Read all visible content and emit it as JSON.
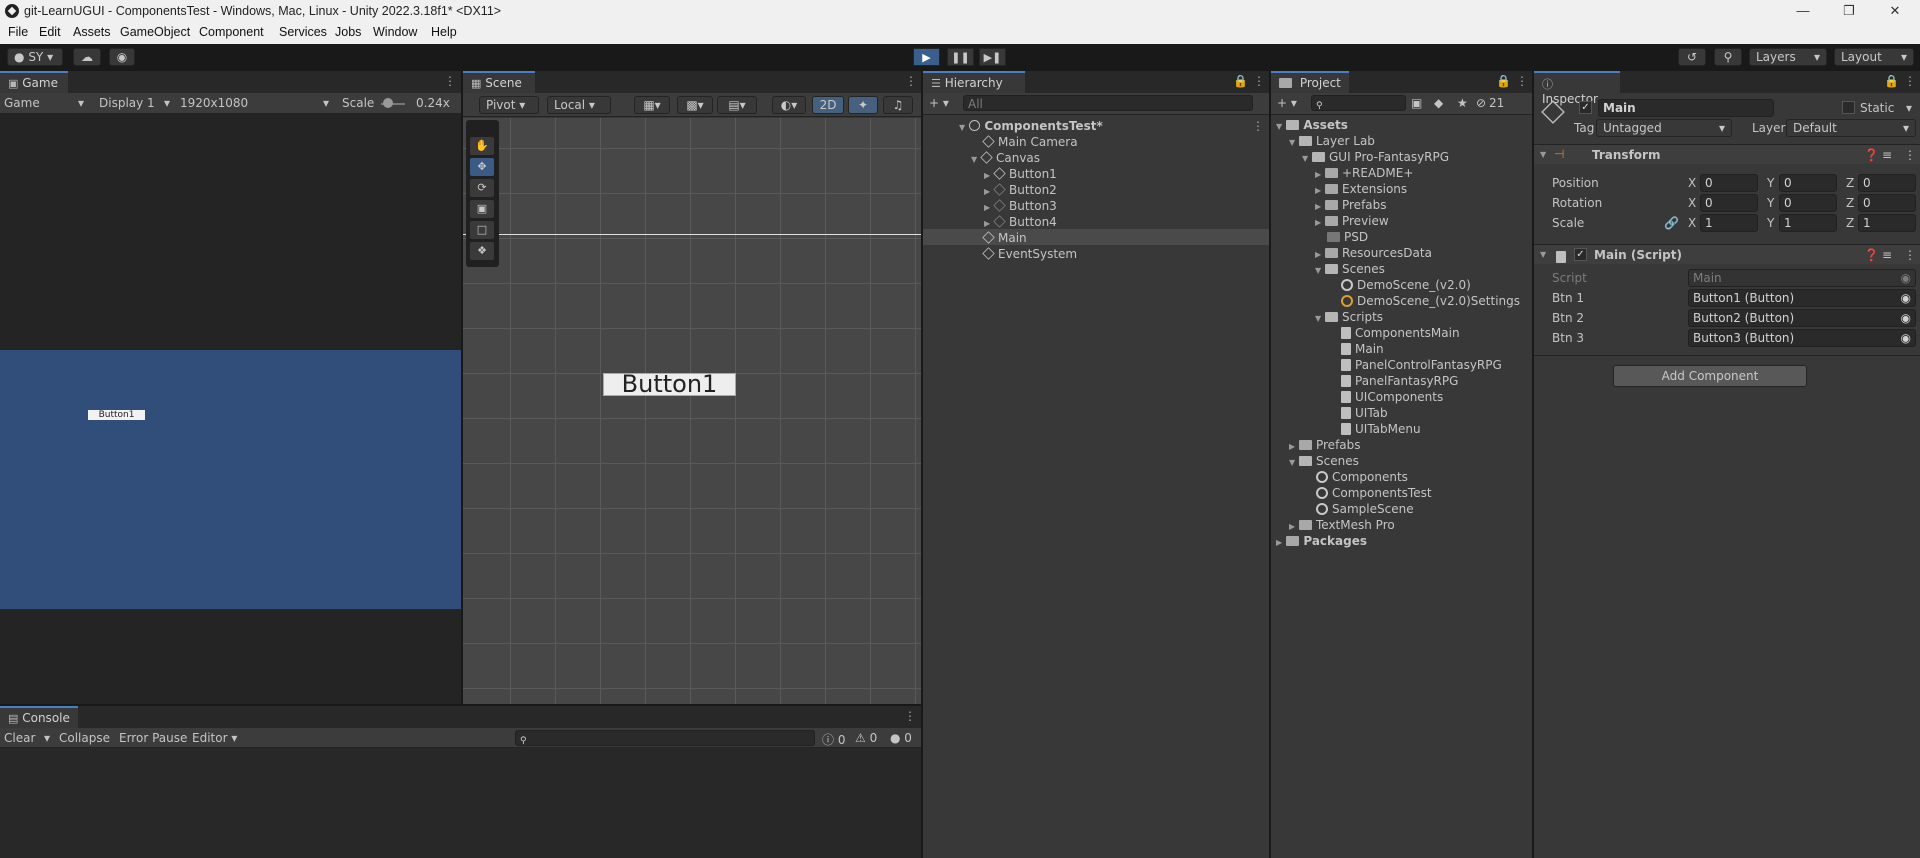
{
  "titlebar": {
    "title": "git-LearnUGUI - ComponentsTest - Windows, Mac, Linux - Unity 2022.3.18f1* <DX11>"
  },
  "menu": [
    "File",
    "Edit",
    "Assets",
    "GameObject",
    "Component",
    "Services",
    "Jobs",
    "Window",
    "Help"
  ],
  "toolbar": {
    "account": "SY",
    "layers": "Layers",
    "layout": "Layout"
  },
  "game": {
    "tab": "Game",
    "mode": "Game",
    "display": "Display 1",
    "resolution": "1920x1080",
    "scale_label": "Scale",
    "scale_value": "0.24x",
    "button_text": "Button1"
  },
  "scene": {
    "tab": "Scene",
    "pivot": "Pivot",
    "local": "Local",
    "mode2d": "2D",
    "button_text": "Button1"
  },
  "hierarchy": {
    "tab": "Hierarchy",
    "search_placeholder": "All",
    "scene_name": "ComponentsTest*",
    "items": [
      {
        "label": "Main Camera",
        "dim": false
      },
      {
        "label": "Canvas",
        "dim": false
      },
      {
        "label": "Button1",
        "dim": false
      },
      {
        "label": "Button2",
        "dim": true
      },
      {
        "label": "Button3",
        "dim": true
      },
      {
        "label": "Button4",
        "dim": true
      },
      {
        "label": "Main",
        "dim": false
      },
      {
        "label": "EventSystem",
        "dim": false
      }
    ]
  },
  "project": {
    "tab": "Project",
    "count": "21",
    "items": [
      "Assets",
      "Layer Lab",
      "GUI Pro-FantasyRPG",
      "+README+",
      "Extensions",
      "Prefabs",
      "Preview",
      "PSD",
      "ResourcesData",
      "Scenes",
      "DemoScene_(v2.0)",
      "DemoScene_(v2.0)Settings",
      "Scripts",
      "ComponentsMain",
      "Main",
      "PanelControlFantasyRPG",
      "PanelFantasyRPG",
      "UIComponents",
      "UITab",
      "UITabMenu",
      "Prefabs",
      "Scenes",
      "Components",
      "ComponentsTest",
      "SampleScene",
      "TextMesh Pro",
      "Packages"
    ]
  },
  "inspector": {
    "tab": "Inspector",
    "object_name": "Main",
    "static_label": "Static",
    "tag_label": "Tag",
    "tag_value": "Untagged",
    "layer_label": "Layer",
    "layer_value": "Default",
    "transform": {
      "title": "Transform",
      "position_label": "Position",
      "position": [
        "0",
        "0",
        "0"
      ],
      "rotation_label": "Rotation",
      "rotation": [
        "0",
        "0",
        "0"
      ],
      "scale_label": "Scale",
      "scale": [
        "1",
        "1",
        "1"
      ],
      "axis": [
        "X",
        "Y",
        "Z"
      ]
    },
    "script": {
      "title": "Main (Script)",
      "script_label": "Script",
      "script_value": "Main",
      "btn1_label": "Btn 1",
      "btn1_value": "Button1 (Button)",
      "btn2_label": "Btn 2",
      "btn2_value": "Button2 (Button)",
      "btn3_label": "Btn 3",
      "btn3_value": "Button3 (Button)"
    },
    "add_component": "Add Component"
  },
  "console": {
    "tab": "Console",
    "clear": "Clear",
    "collapse": "Collapse",
    "error_pause": "Error Pause",
    "editor": "Editor",
    "log_count": "0",
    "warn_count": "0",
    "error_count": "0"
  },
  "colors": {
    "accent": "#4c7ec6",
    "game_bg": "#314d79",
    "panel": "#383838",
    "dark": "#282828"
  }
}
